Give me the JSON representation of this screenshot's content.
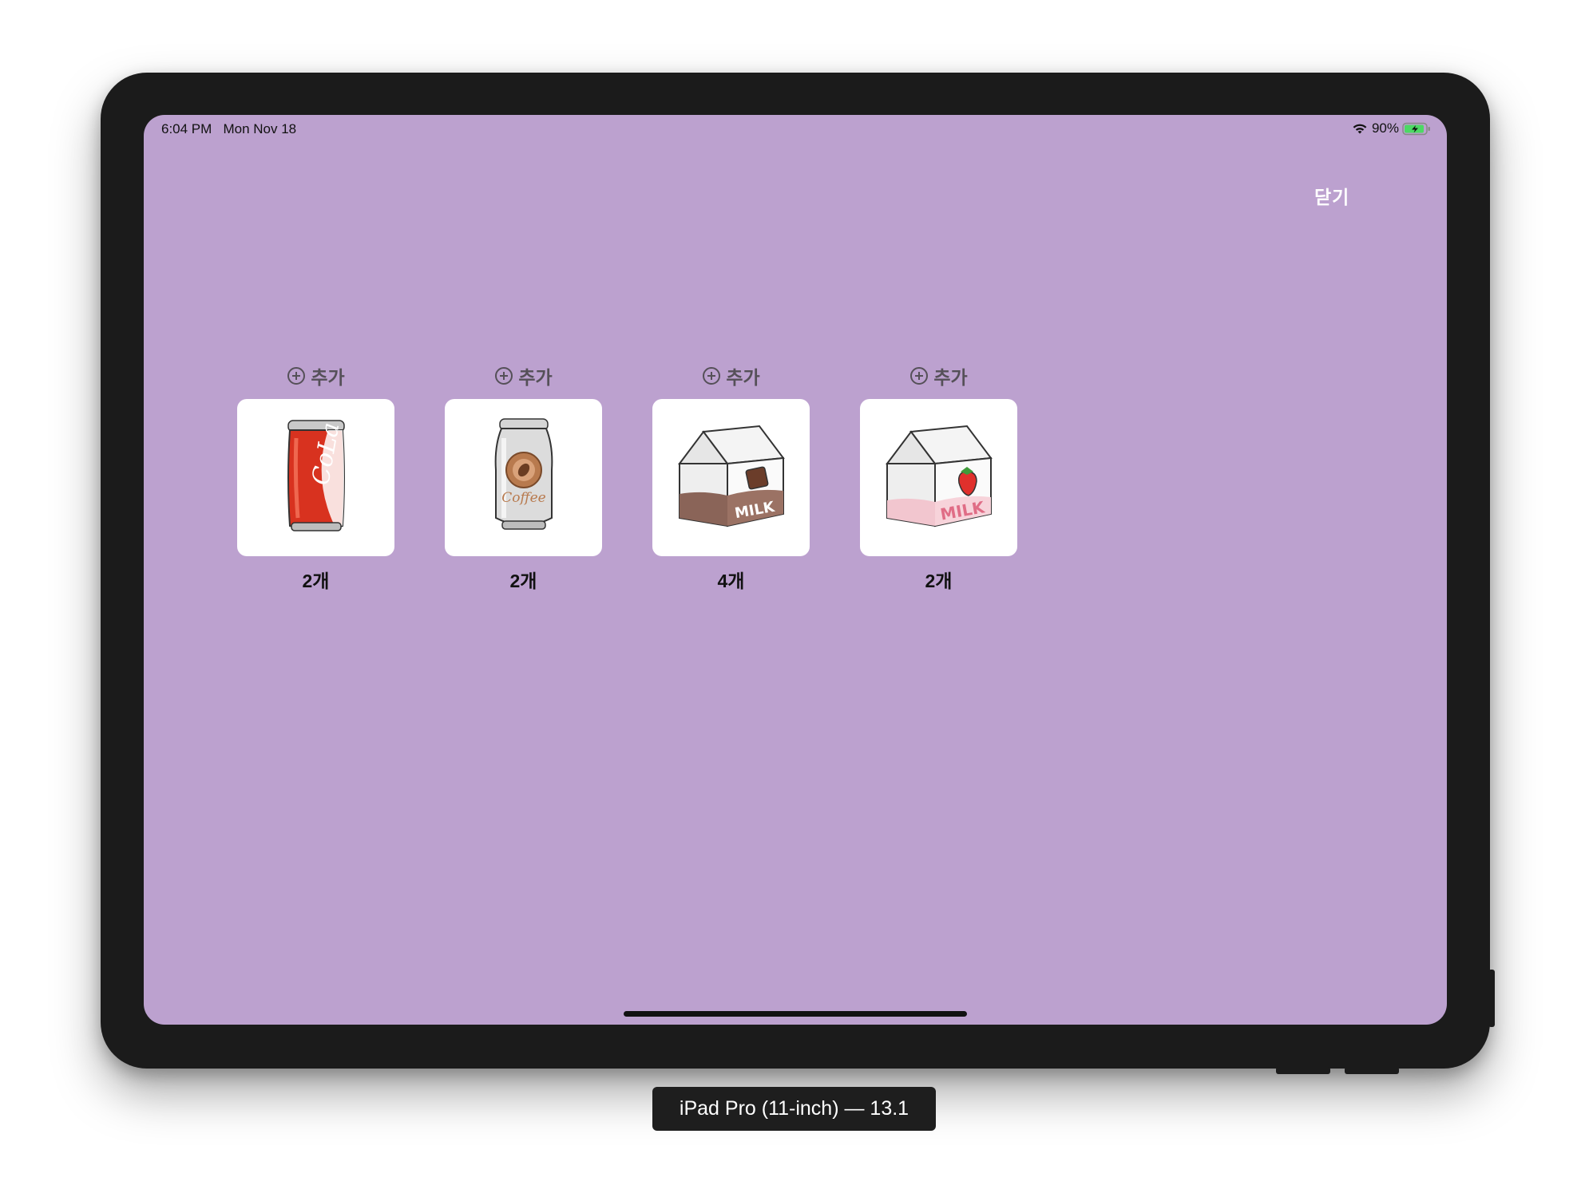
{
  "status_bar": {
    "time": "6:04 PM",
    "date": "Mon Nov 18",
    "battery": "90%",
    "icons": [
      "wifi-icon",
      "battery-charging-icon"
    ]
  },
  "header": {
    "close_label": "닫기"
  },
  "items": [
    {
      "add_label": "추가",
      "image": "cola-can-image",
      "count": "2개"
    },
    {
      "add_label": "추가",
      "image": "coffee-can-image",
      "count": "2개"
    },
    {
      "add_label": "추가",
      "image": "chocolate-milk-carton-image",
      "count": "4개"
    },
    {
      "add_label": "추가",
      "image": "strawberry-milk-carton-image",
      "count": "2개"
    }
  ],
  "simulator": {
    "device_label": "iPad Pro (11-inch) — 13.1"
  },
  "colors": {
    "screen_background": "#bca1cf",
    "card_background": "#ffffff",
    "device_frame": "#1b1b1b",
    "battery_fill": "#4cd964"
  }
}
